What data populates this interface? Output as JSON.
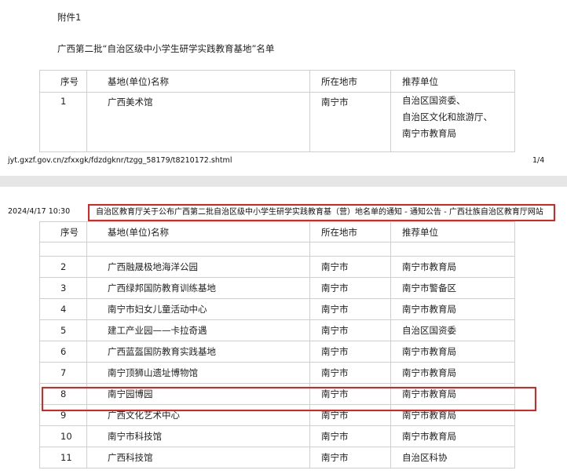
{
  "page1": {
    "attachment_label": "附件1",
    "doc_title": "广西第二批“自治区级中小学生研学实践教育基地”名单",
    "table_headers": [
      "序号",
      "基地(单位)名称",
      "所在地市",
      "推荐单位"
    ],
    "rows": [
      {
        "seq": "1",
        "name": "广西美术馆",
        "city": "南宁市",
        "recommenders": [
          "自治区国资委、",
          "自治区文化和旅游厅、",
          "南宁市教育局"
        ]
      }
    ],
    "footer_url": "jyt.gxzf.gov.cn/zfxxgk/fdzdgknr/tzgg_58179/t8210172.shtml",
    "page_number": "1/4"
  },
  "page2": {
    "print_datetime": "2024/4/17 10:30",
    "print_page_title": "自治区教育厅关于公布广西第二批自治区级中小学生研学实践教育基（营）地名单的通知 - 通知公告 - 广西壮族自治区教育厅网站",
    "table_headers": [
      "序号",
      "基地(单位)名称",
      "所在地市",
      "推荐单位"
    ],
    "rows": [
      {
        "seq": "2",
        "name": "广西融晟极地海洋公园",
        "city": "南宁市",
        "recommender": "南宁市教育局"
      },
      {
        "seq": "3",
        "name": "广西绿邦国防教育训练基地",
        "city": "南宁市",
        "recommender": "南宁市警备区"
      },
      {
        "seq": "4",
        "name": "南宁市妇女儿童活动中心",
        "city": "南宁市",
        "recommender": "南宁市教育局"
      },
      {
        "seq": "5",
        "name": "建工产业园——卡拉奇遇",
        "city": "南宁市",
        "recommender": "自治区国资委"
      },
      {
        "seq": "6",
        "name": "广西蓝盔国防教育实践基地",
        "city": "南宁市",
        "recommender": "南宁市教育局"
      },
      {
        "seq": "7",
        "name": "南宁顶狮山遗址博物馆",
        "city": "南宁市",
        "recommender": "南宁市教育局"
      },
      {
        "seq": "8",
        "name": "南宁园博园",
        "city": "南宁市",
        "recommender": "南宁市教育局"
      },
      {
        "seq": "9",
        "name": "广西文化艺术中心",
        "city": "南宁市",
        "recommender": "南宁市教育局"
      },
      {
        "seq": "10",
        "name": "南宁市科技馆",
        "city": "南宁市",
        "recommender": "南宁市教育局"
      },
      {
        "seq": "11",
        "name": "广西科技馆",
        "city": "南宁市",
        "recommender": "自治区科协"
      }
    ]
  },
  "colors": {
    "highlight": "#e0231e",
    "border": "#cfcfcf",
    "page_gap": "#e6e6e6"
  }
}
